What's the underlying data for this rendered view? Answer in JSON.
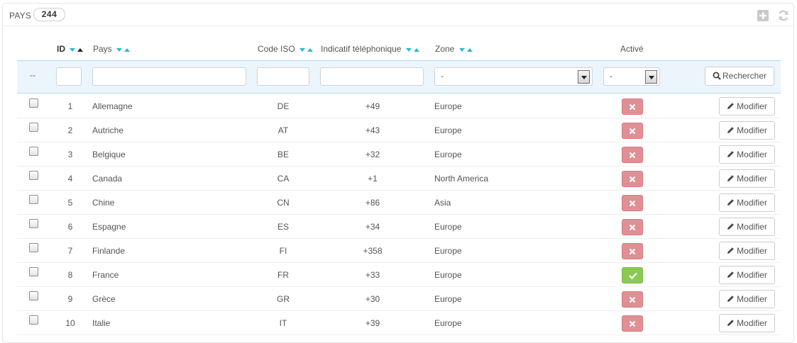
{
  "panel": {
    "title": "PAYS",
    "count": "244"
  },
  "columns": {
    "id": "ID",
    "country": "Pays",
    "iso": "Code ISO",
    "phone": "Indicatif téléphonique",
    "zone": "Zone",
    "active": "Activé"
  },
  "filters": {
    "bulk_placeholder": "--",
    "id_value": "",
    "country_value": "",
    "iso_value": "",
    "phone_value": "",
    "zone_selected": "-",
    "active_selected": "-",
    "search_label": "Rechercher"
  },
  "row_action_label": "Modifier",
  "colors": {
    "disabled_status": "#e08f95",
    "enabled_status": "#8bc954",
    "sort_arrow": "#25b9d7",
    "filter_background": "#ebf5fb"
  },
  "rows": [
    {
      "id": "1",
      "country": "Allemagne",
      "iso": "DE",
      "phone": "+49",
      "zone": "Europe",
      "active": false
    },
    {
      "id": "2",
      "country": "Autriche",
      "iso": "AT",
      "phone": "+43",
      "zone": "Europe",
      "active": false
    },
    {
      "id": "3",
      "country": "Belgique",
      "iso": "BE",
      "phone": "+32",
      "zone": "Europe",
      "active": false
    },
    {
      "id": "4",
      "country": "Canada",
      "iso": "CA",
      "phone": "+1",
      "zone": "North America",
      "active": false
    },
    {
      "id": "5",
      "country": "Chine",
      "iso": "CN",
      "phone": "+86",
      "zone": "Asia",
      "active": false
    },
    {
      "id": "6",
      "country": "Espagne",
      "iso": "ES",
      "phone": "+34",
      "zone": "Europe",
      "active": false
    },
    {
      "id": "7",
      "country": "Finlande",
      "iso": "FI",
      "phone": "+358",
      "zone": "Europe",
      "active": false
    },
    {
      "id": "8",
      "country": "France",
      "iso": "FR",
      "phone": "+33",
      "zone": "Europe",
      "active": true
    },
    {
      "id": "9",
      "country": "Grèce",
      "iso": "GR",
      "phone": "+30",
      "zone": "Europe",
      "active": false
    },
    {
      "id": "10",
      "country": "Italie",
      "iso": "IT",
      "phone": "+39",
      "zone": "Europe",
      "active": false
    }
  ]
}
